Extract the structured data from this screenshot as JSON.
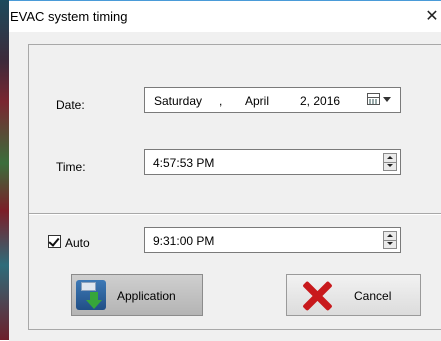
{
  "window": {
    "title": "EVAC system timing",
    "close_glyph": "✕"
  },
  "date": {
    "label": "Date:",
    "weekday": "Saturday",
    "sep": ",",
    "month": "April",
    "day_year": "2, 2016",
    "picker_icon": "calendar-dropdown-icon"
  },
  "time": {
    "label": "Time:",
    "value": "4:57:53 PM"
  },
  "auto": {
    "label": "Auto",
    "checked": true,
    "value": "9:31:00 PM"
  },
  "buttons": {
    "apply_label": "Application",
    "apply_icon": "save-download-icon",
    "cancel_label": "Cancel",
    "cancel_icon": "red-x-icon"
  }
}
